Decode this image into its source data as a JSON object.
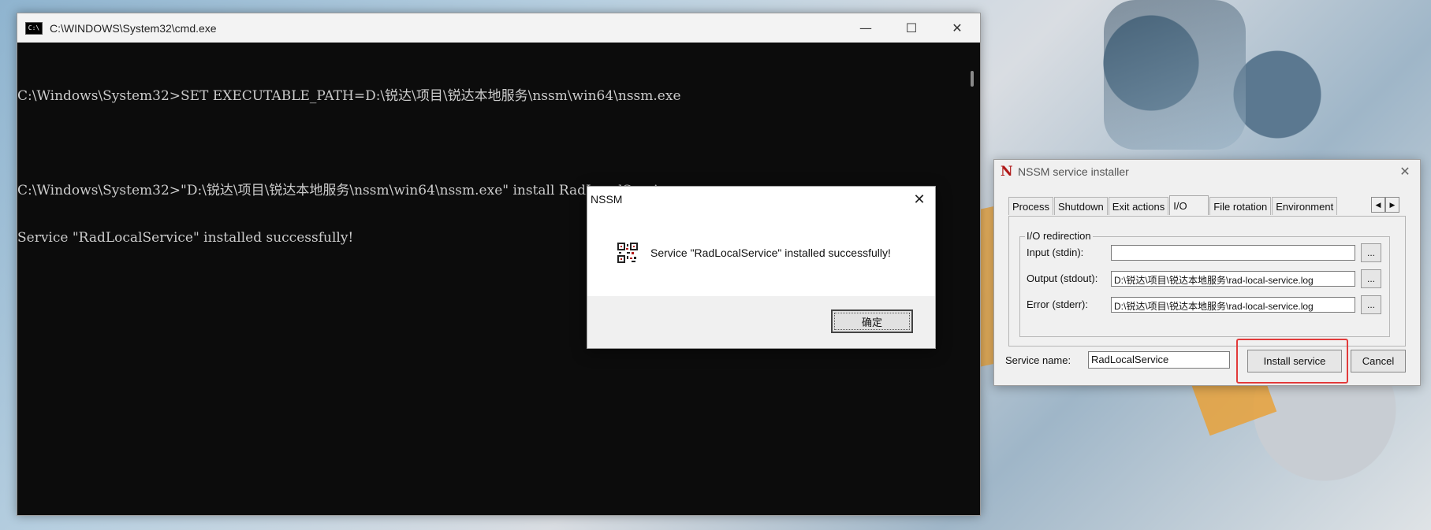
{
  "cmd_window": {
    "title": "C:\\WINDOWS\\System32\\cmd.exe",
    "icon_text": "C:\\",
    "controls": {
      "minimize": "—",
      "maximize": "☐",
      "close": "✕"
    },
    "lines": [
      "C:\\Windows\\System32>SET EXECUTABLE_PATH=D:\\锐达\\项目\\锐达本地服务\\nssm\\win64\\nssm.exe",
      "",
      "C:\\Windows\\System32>\"D:\\锐达\\项目\\锐达本地服务\\nssm\\win64\\nssm.exe\" install RadLocalService",
      "Service \"RadLocalService\" installed successfully!"
    ]
  },
  "message_box": {
    "title": "NSSM",
    "close": "✕",
    "message": "Service \"RadLocalService\" installed successfully!",
    "ok_label": "确定"
  },
  "installer": {
    "logo": "N",
    "title": "NSSM service installer",
    "close": "✕",
    "tabs": [
      "Process",
      "Shutdown",
      "Exit actions",
      "I/O",
      "File rotation",
      "Environment"
    ],
    "active_tab": "I/O",
    "tab_arrows": {
      "left": "◀",
      "right": "▶"
    },
    "group_label": "I/O redirection",
    "fields": [
      {
        "label": "Input (stdin):",
        "value": "",
        "browse": "..."
      },
      {
        "label": "Output (stdout):",
        "value": "D:\\锐达\\项目\\锐达本地服务\\rad-local-service.log",
        "browse": "..."
      },
      {
        "label": "Error (stderr):",
        "value": "D:\\锐达\\项目\\锐达本地服务\\rad-local-service.log",
        "browse": "..."
      }
    ],
    "service_name_label": "Service name:",
    "service_name_value": "RadLocalService",
    "install_label": "Install service",
    "cancel_label": "Cancel",
    "highlight_color": "#e23b3b"
  }
}
